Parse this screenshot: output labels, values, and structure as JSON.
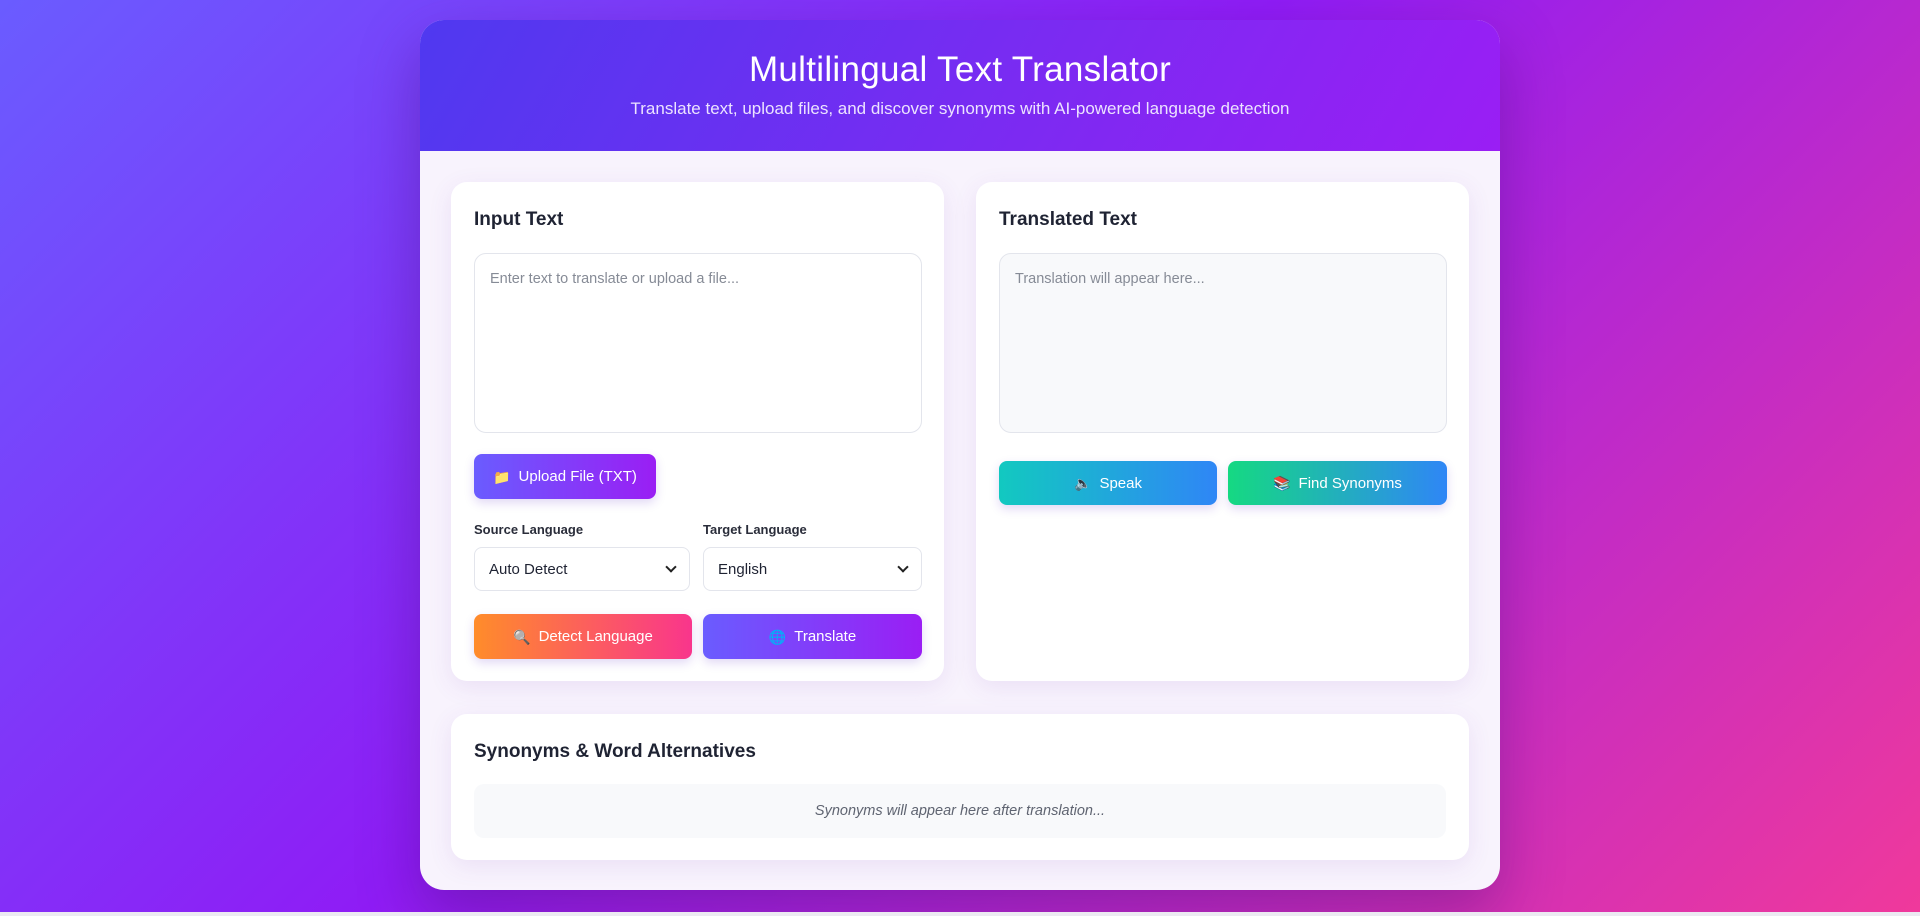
{
  "header": {
    "title": "Multilingual Text Translator",
    "subtitle": "Translate text, upload files, and discover synonyms with AI-powered language detection"
  },
  "input_card": {
    "title": "Input Text",
    "placeholder": "Enter text to translate or upload a file...",
    "upload_button": {
      "icon": "folder-icon",
      "label": "Upload File (TXT)"
    },
    "source_language": {
      "label": "Source Language",
      "selected": "Auto Detect"
    },
    "target_language": {
      "label": "Target Language",
      "selected": "English"
    },
    "detect_button": {
      "icon": "magnifier-icon",
      "label": "Detect Language"
    },
    "translate_button": {
      "icon": "globe-icon",
      "label": "Translate"
    }
  },
  "output_card": {
    "title": "Translated Text",
    "placeholder": "Translation will appear here...",
    "speak_button": {
      "icon": "speaker-icon",
      "label": "Speak"
    },
    "synonyms_button": {
      "icon": "books-icon",
      "label": "Find Synonyms"
    }
  },
  "synonyms_card": {
    "title": "Synonyms & Word Alternatives",
    "placeholder": "Synonyms will appear here after translation..."
  },
  "colors": {
    "accent": "#7a2bf2",
    "page_gradient": [
      "#6a5cff",
      "#8f1cf5",
      "#f0399b"
    ]
  }
}
